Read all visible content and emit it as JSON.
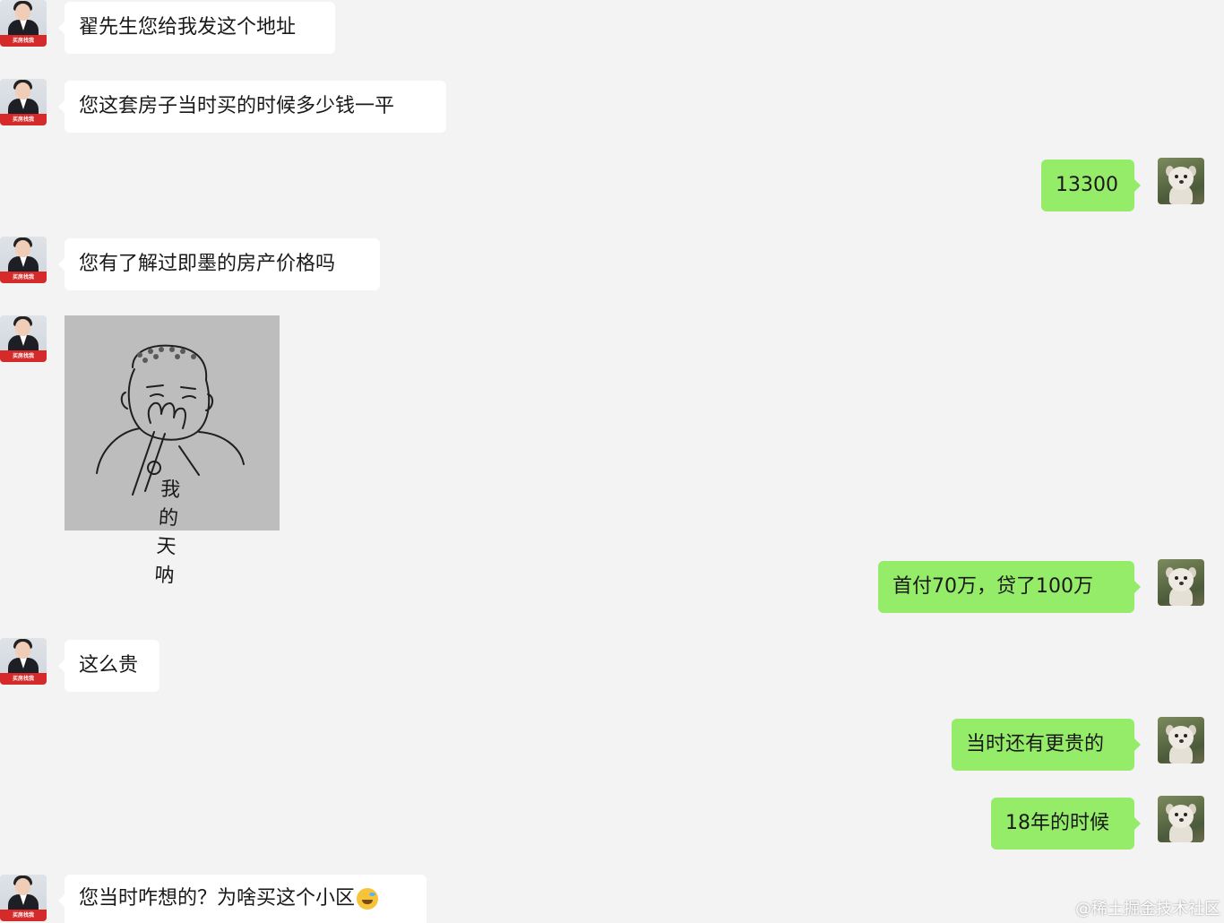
{
  "agent": {
    "avatar_banner": "买房找我"
  },
  "messages": [
    {
      "side": "left",
      "text": "翟先生您给我发这个地址"
    },
    {
      "side": "left",
      "text": "您这套房子当时买的时候多少钱一平"
    },
    {
      "side": "right",
      "text": "13300"
    },
    {
      "side": "left",
      "text": "您有了解过即墨的房产价格吗"
    },
    {
      "side": "left",
      "sticker_text": "我的天呐"
    },
    {
      "side": "right",
      "text": "首付70万，贷了100万"
    },
    {
      "side": "left",
      "text": "这么贵"
    },
    {
      "side": "right",
      "text": "当时还有更贵的"
    },
    {
      "side": "right",
      "text": "18年的时候"
    },
    {
      "side": "left",
      "text": "您当时咋想的？为啥买这个小区",
      "emoji": "laughing-crying-emoji-icon"
    }
  ],
  "watermark": "@稀土掘金技术社区",
  "colors": {
    "background": "#f3f3f3",
    "bubble_left": "#ffffff",
    "bubble_right": "#95ec69"
  }
}
